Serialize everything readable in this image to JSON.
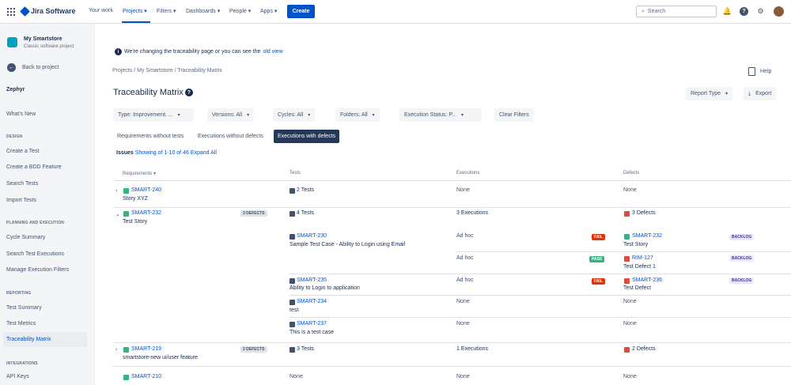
{
  "topnav": {
    "logo": "Jira Software",
    "items": [
      "Your work",
      "Projects",
      "Filters",
      "Dashboards",
      "People",
      "Apps"
    ],
    "create": "Create",
    "search_placeholder": "Search"
  },
  "sidebar": {
    "project_name": "My Smartstore",
    "project_type": "Classic software project",
    "back": "Back to project",
    "zephyr": "Zephyr",
    "whats_new": "What's New",
    "sections": {
      "design": "DESIGN",
      "planning": "PLANNING AND EXECUTION",
      "reporting": "REPORTING",
      "integrations": "INTEGRATIONS"
    },
    "design_items": [
      "Create a Test",
      "Create a BDD Feature",
      "Search Tests",
      "Import Tests"
    ],
    "planning_items": [
      "Cycle Summary",
      "Search Test Executions",
      "Manage Execution Filters"
    ],
    "reporting_items": [
      "Test Summary",
      "Test Metrics",
      "Traceability Matrix"
    ],
    "integration_items": [
      "API Keys"
    ]
  },
  "main": {
    "banner_text": "We're changing the traceability page or you can see the",
    "banner_link": "old view",
    "breadcrumb": "Projects / My Smartstore / Traceability Matrix",
    "help": "Help",
    "title": "Traceability Matrix",
    "report_type": "Report Type",
    "export": "Export",
    "filters": {
      "type": "Type: Improvement, ...",
      "versions": "Versions: All",
      "cycles": "Cycles: All",
      "folders": "Folders: All",
      "execution_status": "Execution Status: P...",
      "clear": "Clear Filters"
    },
    "tabs": [
      "Requirements without tests",
      "Executions without defects",
      "Executions with defects"
    ],
    "issues_label": "Issues",
    "issues_count": "Showing of 1-10 of 46",
    "expand_all": "Expand All",
    "headers": {
      "requirements": "Requirements",
      "tests": "Tests",
      "executions": "Executions",
      "defects": "Defects"
    }
  },
  "rows": {
    "r1": {
      "key": "SMART-240",
      "summary": "Story XYZ",
      "tests": "2 Tests",
      "executions": "None",
      "defects": "None"
    },
    "r2": {
      "key": "SMART-232",
      "summary": "Test Story",
      "badge": "3 DEFECTS",
      "tests": "4 Tests",
      "executions": "3 Executions",
      "defects": "3 Defects",
      "sub": {
        "t1_key": "SMART-230",
        "t1_summary": "Sample Test Case - Ability to Login using Email",
        "e1": "Ad hoc",
        "e1_status": "FAIL",
        "d1_key": "SMART-232",
        "d1_summary": "Test Story",
        "d1_status": "BACKLOG",
        "e2": "Ad hoc",
        "e2_status": "PASS",
        "d2_key": "RIM-127",
        "d2_summary": "Test Defect 1",
        "d2_status": "BACKLOG",
        "t2_key": "SMART-235",
        "t2_summary": "Ability to Login to application",
        "e3": "Ad hoc",
        "e3_status": "FAIL",
        "d3_key": "SMART-236",
        "d3_summary": "Test Defect",
        "d3_status": "BACKLOG",
        "t3_key": "SMART-234",
        "t3_summary": "test",
        "e4": "None",
        "d4": "None",
        "t4_key": "SMART-237",
        "t4_summary": "This is a test case",
        "e5": "None",
        "d5": "None"
      }
    },
    "r3": {
      "key": "SMART-219",
      "summary": "smartstore-new ui/user feature",
      "badge": "2 DEFECTS",
      "tests": "3 Tests",
      "executions": "1 Executions",
      "defects": "2 Defects"
    },
    "r4": {
      "key": "SMART-210",
      "tests": "None",
      "executions": "None",
      "defects": "None"
    }
  }
}
